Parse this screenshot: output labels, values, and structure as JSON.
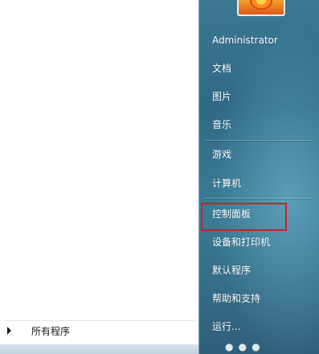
{
  "start_menu": {
    "left": {
      "all_programs_label": "所有程序"
    },
    "right": {
      "user_name": "Administrator",
      "items": [
        {
          "label": "文档"
        },
        {
          "label": "图片"
        },
        {
          "label": "音乐"
        },
        {
          "label": "游戏"
        },
        {
          "label": "计算机"
        },
        {
          "label": "控制面板"
        },
        {
          "label": "设备和打印机"
        },
        {
          "label": "默认程序"
        },
        {
          "label": "帮助和支持"
        },
        {
          "label": "运行..."
        }
      ]
    },
    "highlighted_item": "控制面板",
    "highlight_color": "#d8192a"
  }
}
